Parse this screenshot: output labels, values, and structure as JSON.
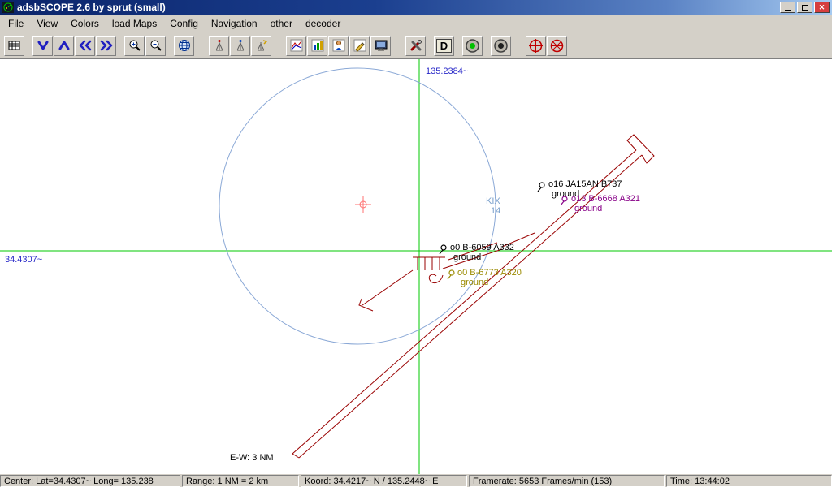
{
  "window": {
    "title": "adsbSCOPE 2.6 by sprut  (small)",
    "controls": [
      "minimize-icon",
      "maximize-icon",
      "close-icon"
    ]
  },
  "menu": {
    "items": [
      "File",
      "View",
      "Colors",
      "load Maps",
      "Config",
      "Navigation",
      "other",
      "decoder"
    ]
  },
  "toolbar": {
    "decoder_label": "D",
    "icons": [
      "table-icon",
      "arrow-down-icon",
      "arrow-up-icon",
      "arrow-left-icon",
      "arrow-right-icon",
      "zoom-in-icon",
      "zoom-out-icon",
      "globe-icon",
      "antenna-icon-1",
      "antenna-icon-2",
      "antenna-icon-3",
      "chart-lines-icon",
      "chart-bars-icon",
      "person-chart-icon",
      "edit-chart-icon",
      "monitor-icon",
      "tools-icon",
      "decoder-run-icon",
      "led-green-icon",
      "led-dark-icon",
      "red-crosshair-icon",
      "red-asterisk-icon"
    ]
  },
  "map": {
    "lon_label": "135.2384~",
    "lat_label": "34.4307~",
    "airport": {
      "name": "KIX",
      "runway": "14"
    },
    "scale_label": "E-W: 3 NM",
    "aircraft": [
      {
        "label": "o16 JA15AN B737",
        "sub": "ground",
        "color": "#000000"
      },
      {
        "label": "o13 B-6668 A321",
        "sub": "ground",
        "color": "#880088"
      },
      {
        "label": "o0 B-6059 A332",
        "sub": "ground",
        "color": "#000000"
      },
      {
        "label": "o0 B-6773 A320",
        "sub": "ground",
        "color": "#9a8a00"
      }
    ],
    "colors": {
      "crosshair_lines": "#00c800",
      "range_ring": "#8aa8d6",
      "center_marker": "#ff7070",
      "airport_outline": "#990000",
      "coord_label": "#2828c8",
      "airport_label": "#7aa0cc"
    }
  },
  "statusbar": {
    "center": "Center: Lat=34.4307~ Long= 135.238",
    "range": "Range: 1 NM = 2 km",
    "koord": "Koord: 34.4217~ N / 135.2448~ E",
    "framerate": "Framerate: 5653 Frames/min (153)",
    "time": "Time: 13:44:02"
  }
}
